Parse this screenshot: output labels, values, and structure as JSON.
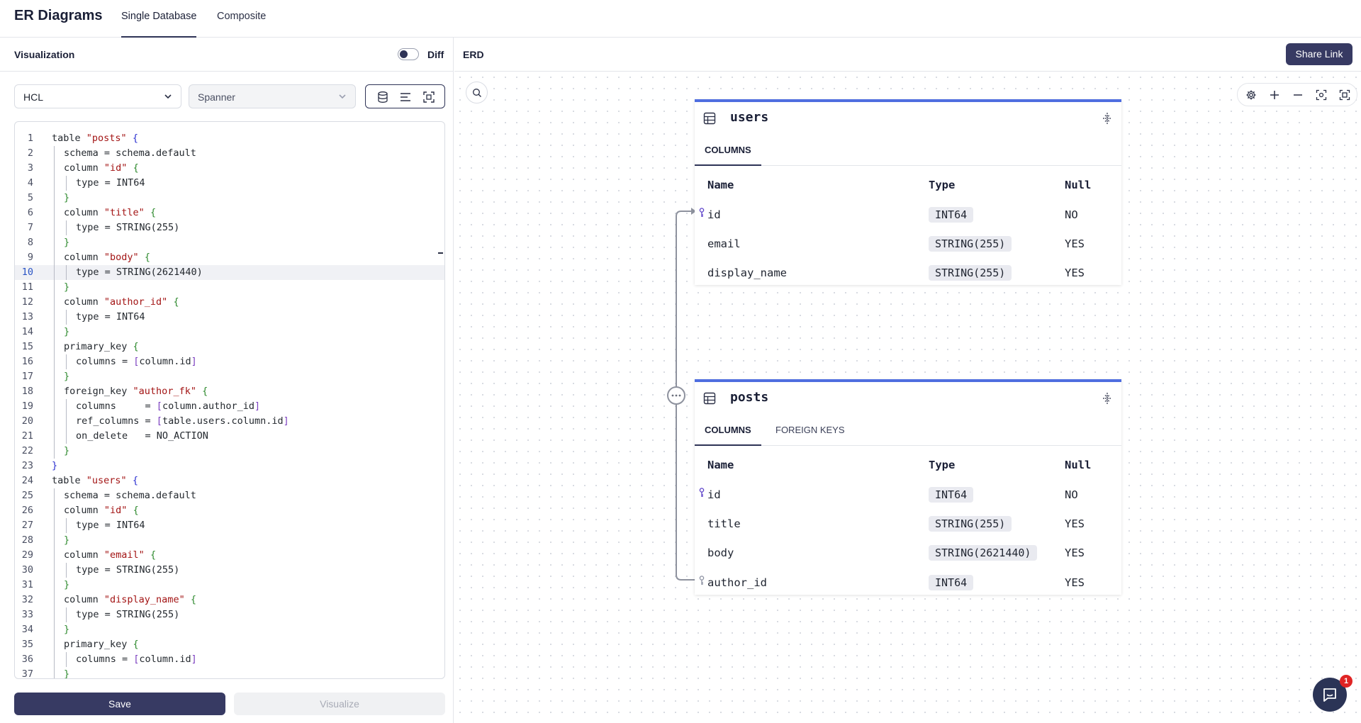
{
  "app": {
    "title": "ER Diagrams",
    "tabs": [
      {
        "label": "Single Database",
        "active": true
      },
      {
        "label": "Composite",
        "active": false
      }
    ]
  },
  "left_panel": {
    "title": "Visualization",
    "diff_label": "Diff",
    "format_select": "HCL",
    "dialect_select": "Spanner",
    "save_label": "Save",
    "visualize_label": "Visualize",
    "highlighted_line": 10
  },
  "code_lines": [
    "table \"posts\" {",
    "schema = schema.default",
    "column \"id\" {",
    "type = INT64",
    "}",
    "column \"title\" {",
    "type = STRING(255)",
    "}",
    "column \"body\" {",
    "type = STRING(2621440)",
    "}",
    "column \"author_id\" {",
    "type = INT64",
    "}",
    "primary_key {",
    "columns = [column.id]",
    "}",
    "foreign_key \"author_fk\" {",
    "columns     = [column.author_id]",
    "ref_columns = [table.users.column.id]",
    "on_delete   = NO_ACTION",
    "}",
    "}",
    "table \"users\" {",
    "schema = schema.default",
    "column \"id\" {",
    "type = INT64",
    "}",
    "column \"email\" {",
    "type = STRING(255)",
    "}",
    "column \"display_name\" {",
    "type = STRING(255)",
    "}",
    "primary_key {",
    "columns = [column.id]",
    "}"
  ],
  "line_numbers": [
    "1",
    "2",
    "3",
    "4",
    "5",
    "6",
    "7",
    "8",
    "9",
    "10",
    "11",
    "12",
    "13",
    "14",
    "15",
    "16",
    "17",
    "18",
    "19",
    "20",
    "21",
    "22",
    "23",
    "24",
    "25",
    "26",
    "27",
    "28",
    "29",
    "30",
    "31",
    "32",
    "33",
    "34",
    "35",
    "36",
    "37"
  ],
  "right_panel": {
    "title": "ERD",
    "share_label": "Share Link"
  },
  "erd_tables": {
    "users": {
      "name": "users",
      "tabs": [
        "COLUMNS"
      ],
      "headers": {
        "name": "Name",
        "type": "Type",
        "null": "Null"
      },
      "rows": [
        {
          "name": "id",
          "type": "INT64",
          "null": "NO",
          "key": "primary"
        },
        {
          "name": "email",
          "type": "STRING(255)",
          "null": "YES"
        },
        {
          "name": "display_name",
          "type": "STRING(255)",
          "null": "YES"
        }
      ]
    },
    "posts": {
      "name": "posts",
      "tabs": [
        "COLUMNS",
        "FOREIGN KEYS"
      ],
      "headers": {
        "name": "Name",
        "type": "Type",
        "null": "Null"
      },
      "rows": [
        {
          "name": "id",
          "type": "INT64",
          "null": "NO",
          "key": "primary"
        },
        {
          "name": "title",
          "type": "STRING(255)",
          "null": "YES"
        },
        {
          "name": "body",
          "type": "STRING(2621440)",
          "null": "YES"
        },
        {
          "name": "author_id",
          "type": "INT64",
          "null": "YES",
          "key": "foreign"
        }
      ]
    }
  },
  "chat": {
    "badge": "1"
  },
  "colors": {
    "accent": "#373a63",
    "table_border": "#4f6ee0"
  }
}
